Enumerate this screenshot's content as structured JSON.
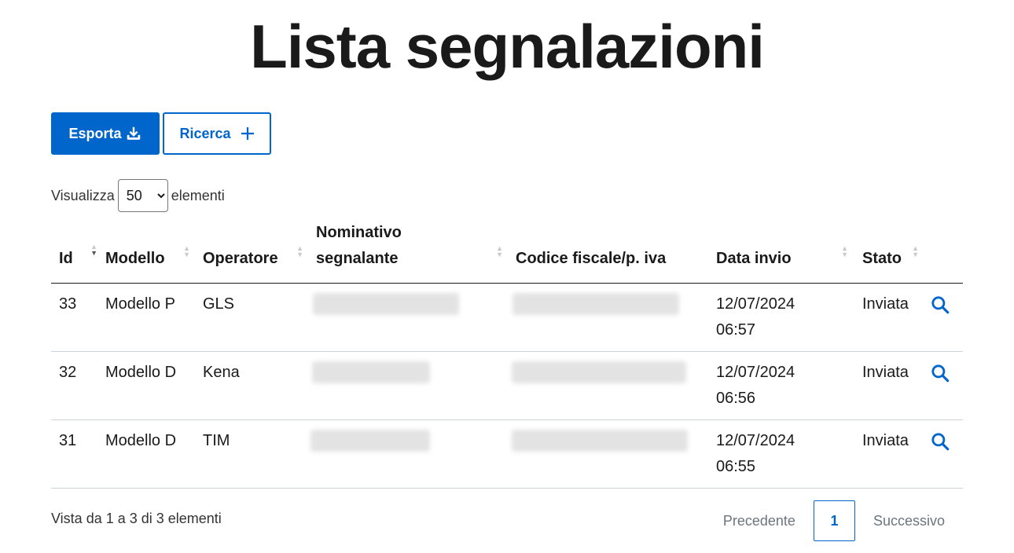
{
  "page": {
    "title": "Lista segnalazioni"
  },
  "toolbar": {
    "export_label": "Esporta",
    "export_icon": "download-icon",
    "search_label": "Ricerca",
    "search_icon": "plus-icon"
  },
  "length_menu": {
    "prefix": "Visualizza",
    "selected": "50",
    "options": [
      "50"
    ],
    "suffix": "elementi"
  },
  "table": {
    "columns": [
      {
        "label": "Id",
        "sorted": "desc"
      },
      {
        "label": "Modello",
        "sorted": "none"
      },
      {
        "label": "Operatore",
        "sorted": "none"
      },
      {
        "label": "Nominativo segnalante",
        "sorted": "none"
      },
      {
        "label": "Codice fiscale/p. iva",
        "sorted": "none"
      },
      {
        "label": "Data invio",
        "sorted": "none"
      },
      {
        "label": "Stato",
        "sorted": "none"
      }
    ],
    "rows": [
      {
        "id": "33",
        "modello": "Modello P",
        "operatore": "GLS",
        "nominativo": "",
        "codice": "",
        "data": "12/07/2024",
        "ora": "06:57",
        "stato": "Inviata"
      },
      {
        "id": "32",
        "modello": "Modello D",
        "operatore": "Kena",
        "nominativo": "",
        "codice": "",
        "data": "12/07/2024",
        "ora": "06:56",
        "stato": "Inviata"
      },
      {
        "id": "31",
        "modello": "Modello D",
        "operatore": "TIM",
        "nominativo": "",
        "codice": "",
        "data": "12/07/2024",
        "ora": "06:55",
        "stato": "Inviata"
      }
    ],
    "row_action_icon": "search-icon"
  },
  "footer": {
    "info": "Vista da 1 a 3 di 3 elementi",
    "prev_label": "Precedente",
    "current_page": "1",
    "next_label": "Successivo"
  },
  "colors": {
    "primary": "#0066cc",
    "text": "#1a1a1a",
    "muted": "#6c757d"
  }
}
